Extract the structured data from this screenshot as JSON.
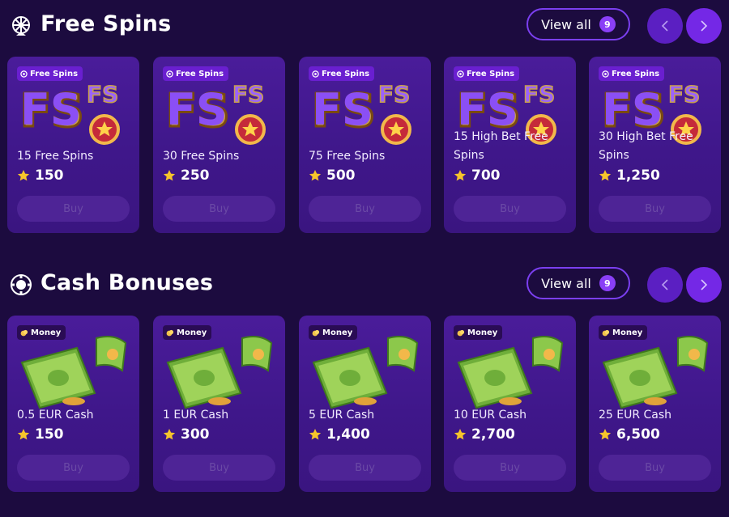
{
  "sections": [
    {
      "title": "Free Spins",
      "icon": "wheel-icon",
      "view_all_label": "View all",
      "view_all_count": "9",
      "items": [
        {
          "tag": "Free Spins",
          "name": "15 Free Spins",
          "price": "150",
          "buy": "Buy"
        },
        {
          "tag": "Free Spins",
          "name": "30 Free Spins",
          "price": "250",
          "buy": "Buy"
        },
        {
          "tag": "Free Spins",
          "name": "75 Free Spins",
          "price": "500",
          "buy": "Buy"
        },
        {
          "tag": "Free Spins",
          "name": "15 High Bet Free Spins",
          "price": "700",
          "buy": "Buy"
        },
        {
          "tag": "Free Spins",
          "name": "30 High Bet Free Spins",
          "price": "1,250",
          "buy": "Buy"
        }
      ]
    },
    {
      "title": "Cash Bonuses",
      "icon": "casino-chip-icon",
      "view_all_label": "View all",
      "view_all_count": "9",
      "items": [
        {
          "tag": "Money",
          "name": "0.5 EUR Cash",
          "price": "150",
          "buy": "Buy"
        },
        {
          "tag": "Money",
          "name": "1 EUR Cash",
          "price": "300",
          "buy": "Buy"
        },
        {
          "tag": "Money",
          "name": "5 EUR Cash",
          "price": "1,400",
          "buy": "Buy"
        },
        {
          "tag": "Money",
          "name": "10 EUR Cash",
          "price": "2,700",
          "buy": "Buy"
        },
        {
          "tag": "Money",
          "name": "25 EUR Cash",
          "price": "6,500",
          "buy": "Buy"
        }
      ]
    }
  ],
  "colors": {
    "background": "#1c0b3f",
    "card": "#4a1c9a",
    "accent": "#7428e6",
    "star": "#f7c52b"
  }
}
